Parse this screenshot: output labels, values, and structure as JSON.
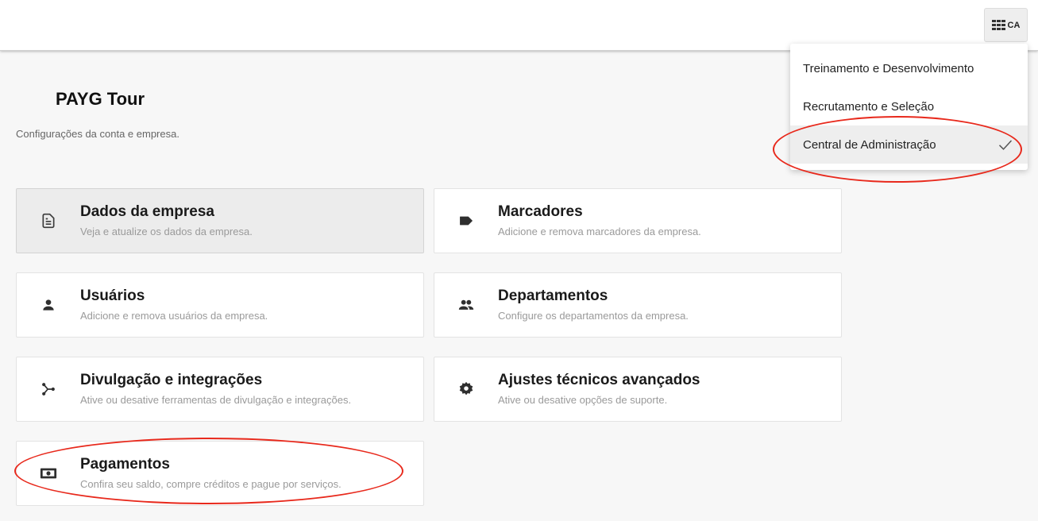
{
  "topbar": {
    "app_switch_label": "CA"
  },
  "page": {
    "title": "PAYG Tour",
    "subtitle": "Configurações da conta e empresa."
  },
  "cards": [
    {
      "title": "Dados da empresa",
      "desc": "Veja e atualize os dados da empresa.",
      "icon": "document-icon"
    },
    {
      "title": "Marcadores",
      "desc": "Adicione e remova marcadores da empresa.",
      "icon": "tag-icon"
    },
    {
      "title": "Usuários",
      "desc": "Adicione e remova usuários da empresa.",
      "icon": "person-icon"
    },
    {
      "title": "Departamentos",
      "desc": "Configure os departamentos da empresa.",
      "icon": "people-icon"
    },
    {
      "title": "Divulgação e integrações",
      "desc": "Ative ou desative ferramentas de divulgação e integrações.",
      "icon": "share-icon"
    },
    {
      "title": "Ajustes técnicos avançados",
      "desc": "Ative ou desative opções de suporte.",
      "icon": "gear-icon"
    },
    {
      "title": "Pagamentos",
      "desc": "Confira seu saldo, compre créditos e pague por serviços.",
      "icon": "money-icon"
    }
  ],
  "dropdown": {
    "items": [
      {
        "label": "Treinamento e Desenvolvimento"
      },
      {
        "label": "Recrutamento e Seleção"
      },
      {
        "label": "Central de Administração"
      }
    ],
    "selected": "Central de Administração"
  },
  "colors": {
    "annotation": "#e8291c",
    "icon": "#3a3a3a"
  }
}
